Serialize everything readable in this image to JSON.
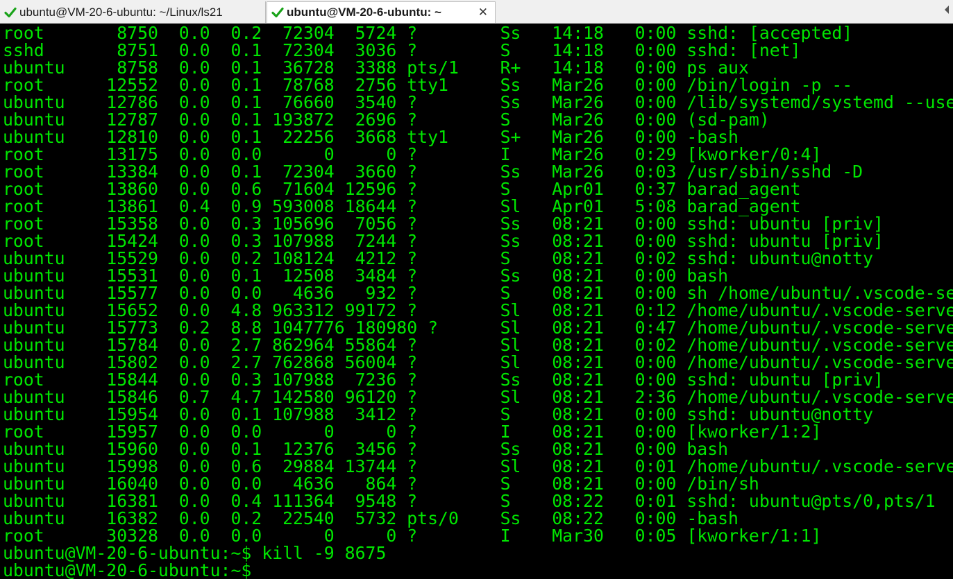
{
  "tabs": [
    {
      "title": "ubuntu@VM-20-6-ubuntu: ~/Linux/ls21",
      "status_icon": "check-icon",
      "active": false
    },
    {
      "title": "ubuntu@VM-20-6-ubuntu: ~",
      "status_icon": "check-icon",
      "active": true,
      "close": "✕"
    }
  ],
  "colors": {
    "terminal_bg": "#000000",
    "terminal_fg": "#00e600",
    "check": "#1aa31a"
  },
  "terminal": {
    "lines": [
      "root       8750  0.0  0.2  72304  5724 ?        Ss   14:18   0:00 sshd: [accepted]",
      "sshd       8751  0.0  0.1  72304  3036 ?        S    14:18   0:00 sshd: [net]",
      "ubuntu     8758  0.0  0.1  36728  3388 pts/1    R+   14:18   0:00 ps aux",
      "root      12552  0.0  0.1  78768  2756 tty1     Ss   Mar26   0:00 /bin/login -p --",
      "ubuntu    12786  0.0  0.1  76660  3540 ?        Ss   Mar26   0:00 /lib/systemd/systemd --use",
      "ubuntu    12787  0.0  0.1 193872  2696 ?        S    Mar26   0:00 (sd-pam)",
      "ubuntu    12810  0.0  0.1  22256  3668 tty1     S+   Mar26   0:00 -bash",
      "root      13175  0.0  0.0      0     0 ?        I    Mar26   0:29 [kworker/0:4]",
      "root      13384  0.0  0.1  72304  3660 ?        Ss   Mar26   0:03 /usr/sbin/sshd -D",
      "root      13860  0.0  0.6  71604 12596 ?        S    Apr01   0:37 barad_agent",
      "root      13861  0.4  0.9 593008 18644 ?        Sl   Apr01   5:08 barad_agent",
      "root      15358  0.0  0.3 105696  7056 ?        Ss   08:21   0:00 sshd: ubuntu [priv]",
      "root      15424  0.0  0.3 107988  7244 ?        Ss   08:21   0:00 sshd: ubuntu [priv]",
      "ubuntu    15529  0.0  0.2 108124  4212 ?        S    08:21   0:02 sshd: ubuntu@notty",
      "ubuntu    15531  0.0  0.1  12508  3484 ?        Ss   08:21   0:00 bash",
      "ubuntu    15577  0.0  0.0   4636   932 ?        S    08:21   0:00 sh /home/ubuntu/.vscode-se",
      "ubuntu    15652  0.0  4.8 963312 99172 ?        Sl   08:21   0:12 /home/ubuntu/.vscode-serve",
      "ubuntu    15773  0.2  8.8 1047776 180980 ?      Sl   08:21   0:47 /home/ubuntu/.vscode-serve",
      "ubuntu    15784  0.0  2.7 862964 55864 ?        Sl   08:21   0:02 /home/ubuntu/.vscode-serve",
      "ubuntu    15802  0.0  2.7 762868 56004 ?        Sl   08:21   0:00 /home/ubuntu/.vscode-serve",
      "root      15844  0.0  0.3 107988  7236 ?        Ss   08:21   0:00 sshd: ubuntu [priv]",
      "ubuntu    15846  0.7  4.7 142580 96120 ?        Sl   08:21   2:36 /home/ubuntu/.vscode-serve",
      "ubuntu    15954  0.0  0.1 107988  3412 ?        S    08:21   0:00 sshd: ubuntu@notty",
      "root      15957  0.0  0.0      0     0 ?        I    08:21   0:00 [kworker/1:2]",
      "ubuntu    15960  0.0  0.1  12376  3456 ?        Ss   08:21   0:00 bash",
      "ubuntu    15998  0.0  0.6  29884 13744 ?        Sl   08:21   0:01 /home/ubuntu/.vscode-serve",
      "ubuntu    16040  0.0  0.0   4636   864 ?        S    08:21   0:00 /bin/sh",
      "ubuntu    16381  0.0  0.4 111364  9548 ?        S    08:22   0:01 sshd: ubuntu@pts/0,pts/1",
      "ubuntu    16382  0.0  0.2  22540  5732 pts/0    Ss   08:22   0:00 -bash",
      "root      30328  0.0  0.0      0     0 ?        I    Mar30   0:05 [kworker/1:1]",
      "ubuntu@VM-20-6-ubuntu:~$ kill -9 8675",
      "ubuntu@VM-20-6-ubuntu:~$ "
    ]
  }
}
